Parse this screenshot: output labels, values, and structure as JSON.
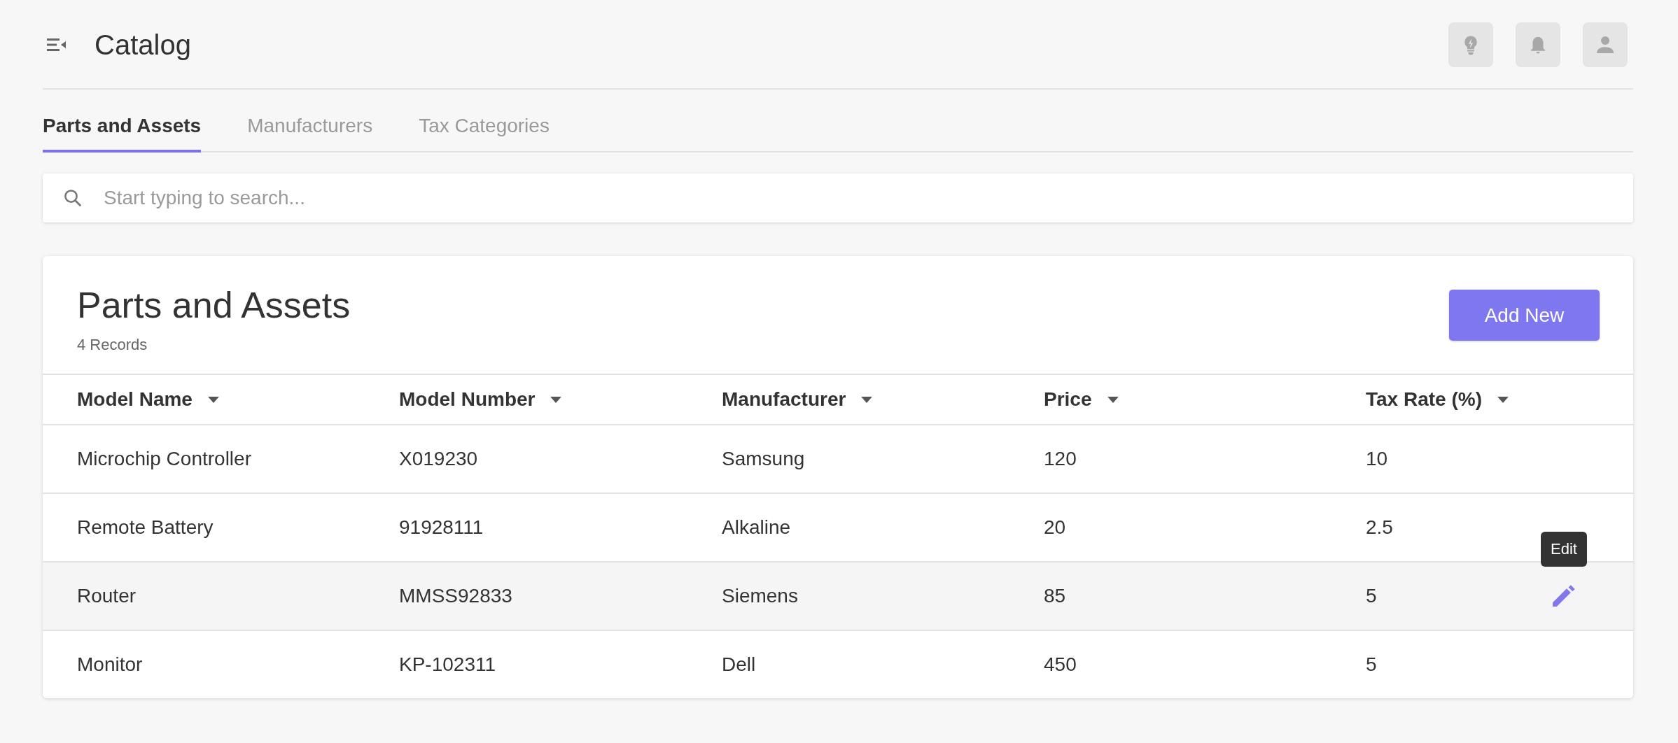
{
  "header": {
    "title": "Catalog"
  },
  "tabs": [
    {
      "label": "Parts and Assets",
      "selected": true
    },
    {
      "label": "Manufacturers",
      "selected": false
    },
    {
      "label": "Tax Categories",
      "selected": false
    }
  ],
  "search": {
    "placeholder": "Start typing to search..."
  },
  "card": {
    "title": "Parts and Assets",
    "count": "4 Records",
    "add_button": "Add New"
  },
  "table": {
    "columns": [
      "Model Name",
      "Model Number",
      "Manufacturer",
      "Price",
      "Tax Rate (%)"
    ],
    "rows": [
      {
        "cells": [
          "Microchip Controller",
          "X019230",
          "Samsung",
          "120",
          "10"
        ],
        "hovered": false
      },
      {
        "cells": [
          "Remote Battery",
          "91928111",
          "Alkaline",
          "20",
          "2.5"
        ],
        "hovered": false
      },
      {
        "cells": [
          "Router",
          "MMSS92833",
          "Siemens",
          "85",
          "5"
        ],
        "hovered": true,
        "tooltip": "Edit"
      },
      {
        "cells": [
          "Monitor",
          "KP-102311",
          "Dell",
          "450",
          "5"
        ],
        "hovered": false
      }
    ]
  }
}
